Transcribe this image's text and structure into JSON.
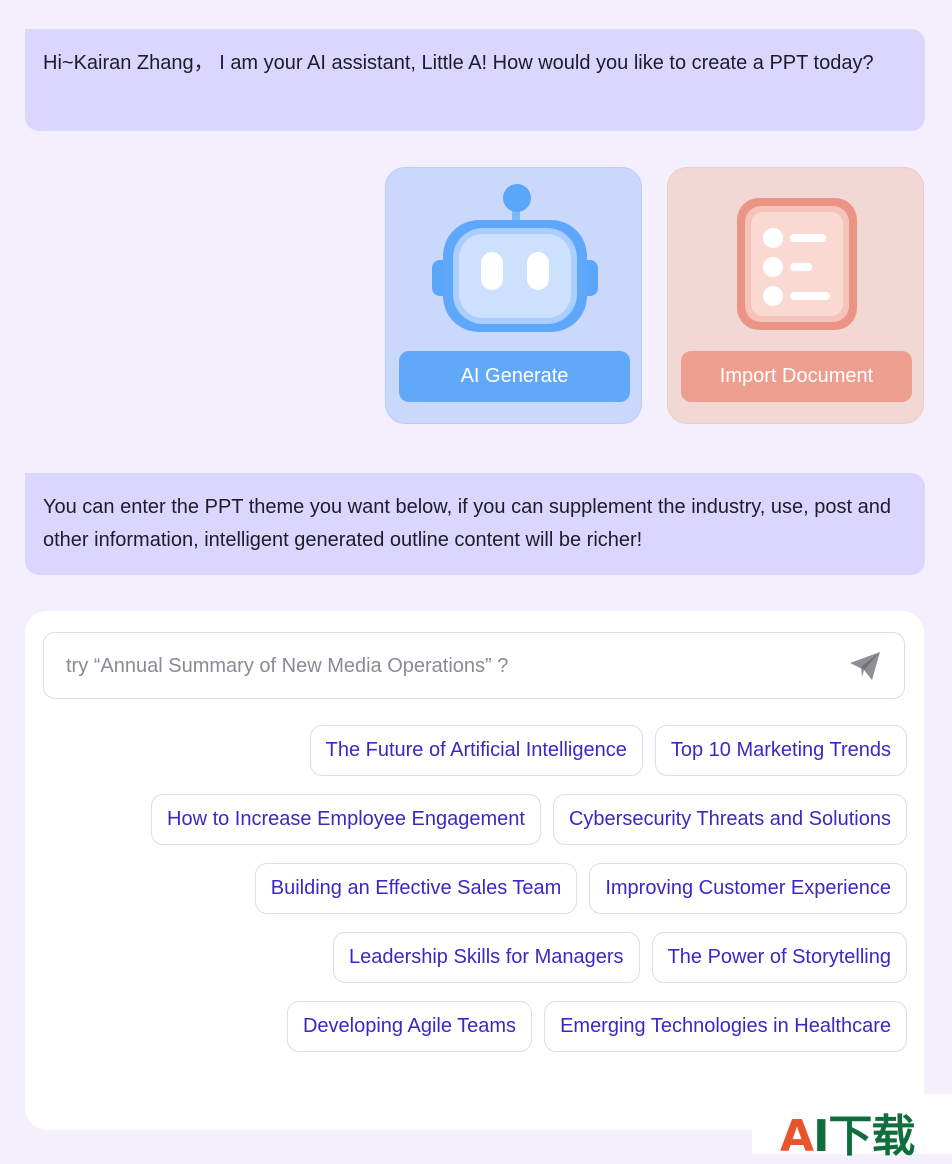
{
  "messages": {
    "greeting": "Hi~Kairan Zhang， I am your AI assistant, Little A! How would you like to create a PPT today?",
    "instruction": "You can enter the PPT theme you want below, if you can supplement the industry, use, post and other information, intelligent generated outline content will be richer!"
  },
  "options": {
    "ai_generate": {
      "label": "AI Generate",
      "icon": "robot-icon",
      "color": "#62a8f8"
    },
    "import_document": {
      "label": "Import Document",
      "icon": "document-list-icon",
      "color": "#ee9e8e"
    }
  },
  "search": {
    "placeholder": "try “Annual Summary of New Media Operations” ?",
    "send_icon": "send-paper-plane-icon"
  },
  "suggestions": [
    [
      "The Future of Artificial Intelligence",
      "Top 10 Marketing Trends"
    ],
    [
      "How to Increase Employee Engagement",
      "Cybersecurity Threats and Solutions"
    ],
    [
      "Building an Effective Sales Team",
      "Improving Customer Experience"
    ],
    [
      "Leadership Skills for Managers",
      "The Power of Storytelling"
    ],
    [
      "Developing Agile Teams",
      "Emerging Technologies in Healthcare"
    ]
  ],
  "watermark": {
    "accent": "A",
    "rest": "I下载"
  },
  "colors": {
    "accent": "#3b28c4",
    "bubble": "#dad6fd",
    "background": "#f3effd"
  }
}
